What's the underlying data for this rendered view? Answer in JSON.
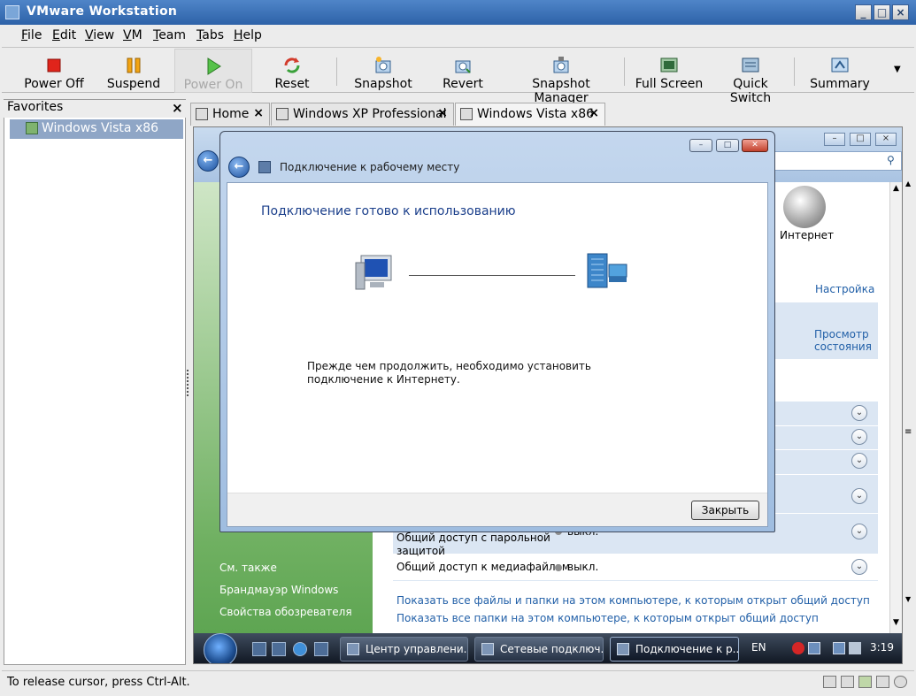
{
  "window": {
    "title": "VMware Workstation"
  },
  "menubar": {
    "items": [
      {
        "label": "File",
        "underline": "F",
        "rest": "ile"
      },
      {
        "label": "Edit",
        "underline": "E",
        "rest": "dit"
      },
      {
        "label": "View",
        "underline": "V",
        "rest": "iew"
      },
      {
        "label": "VM",
        "underline": "V",
        "rest": "M"
      },
      {
        "label": "Team",
        "underline": "T",
        "rest": "eam"
      },
      {
        "label": "Tabs",
        "underline": "T",
        "rest": "abs"
      },
      {
        "label": "Help",
        "underline": "H",
        "rest": "elp"
      }
    ]
  },
  "toolbar": {
    "power_off": "Power Off",
    "suspend": "Suspend",
    "power_on": "Power On",
    "reset": "Reset",
    "snapshot": "Snapshot",
    "revert": "Revert",
    "snapshot_manager": "Snapshot Manager",
    "full_screen": "Full Screen",
    "quick_switch": "Quick Switch",
    "summary": "Summary"
  },
  "favorites": {
    "title": "Favorites",
    "items": [
      "Windows Vista x86"
    ]
  },
  "tabs": [
    {
      "label": "Home"
    },
    {
      "label": "Windows XP Professional"
    },
    {
      "label": "Windows Vista x86"
    }
  ],
  "guest": {
    "background_window": {
      "internet_label": "Интернет",
      "customize_link": "Настройка",
      "view_status_link_line1": "Просмотр",
      "view_status_link_line2": "состояния",
      "row_password_line1": "Общий доступ с парольной",
      "row_password_line2": "защитой",
      "row_password_value": "выкл.",
      "row_media_label": "Общий доступ к медиафайлам",
      "row_media_value": "выкл.",
      "link_files": "Показать все файлы и папки на этом компьютере, к которым открыт общий доступ",
      "link_folders": "Показать все папки на этом компьютере, к которым открыт общий доступ",
      "see_also": "См. также",
      "side_link_firewall": "Брандмауэр Windows",
      "side_link_browser": "Свойства обозревателя"
    },
    "dialog": {
      "title": "Подключение к рабочему месту",
      "heading": "Подключение готово к использованию",
      "message": "Прежде чем продолжить, необходимо установить подключение к Интернету.",
      "close_button": "Закрыть"
    },
    "taskbar": {
      "tasks": [
        {
          "label": "Центр управлени..."
        },
        {
          "label": "Сетевые подключ..."
        },
        {
          "label": "Подключение к р..."
        }
      ],
      "language": "EN",
      "clock": "3:19"
    }
  },
  "status": {
    "text": "To release cursor, press Ctrl-Alt."
  }
}
